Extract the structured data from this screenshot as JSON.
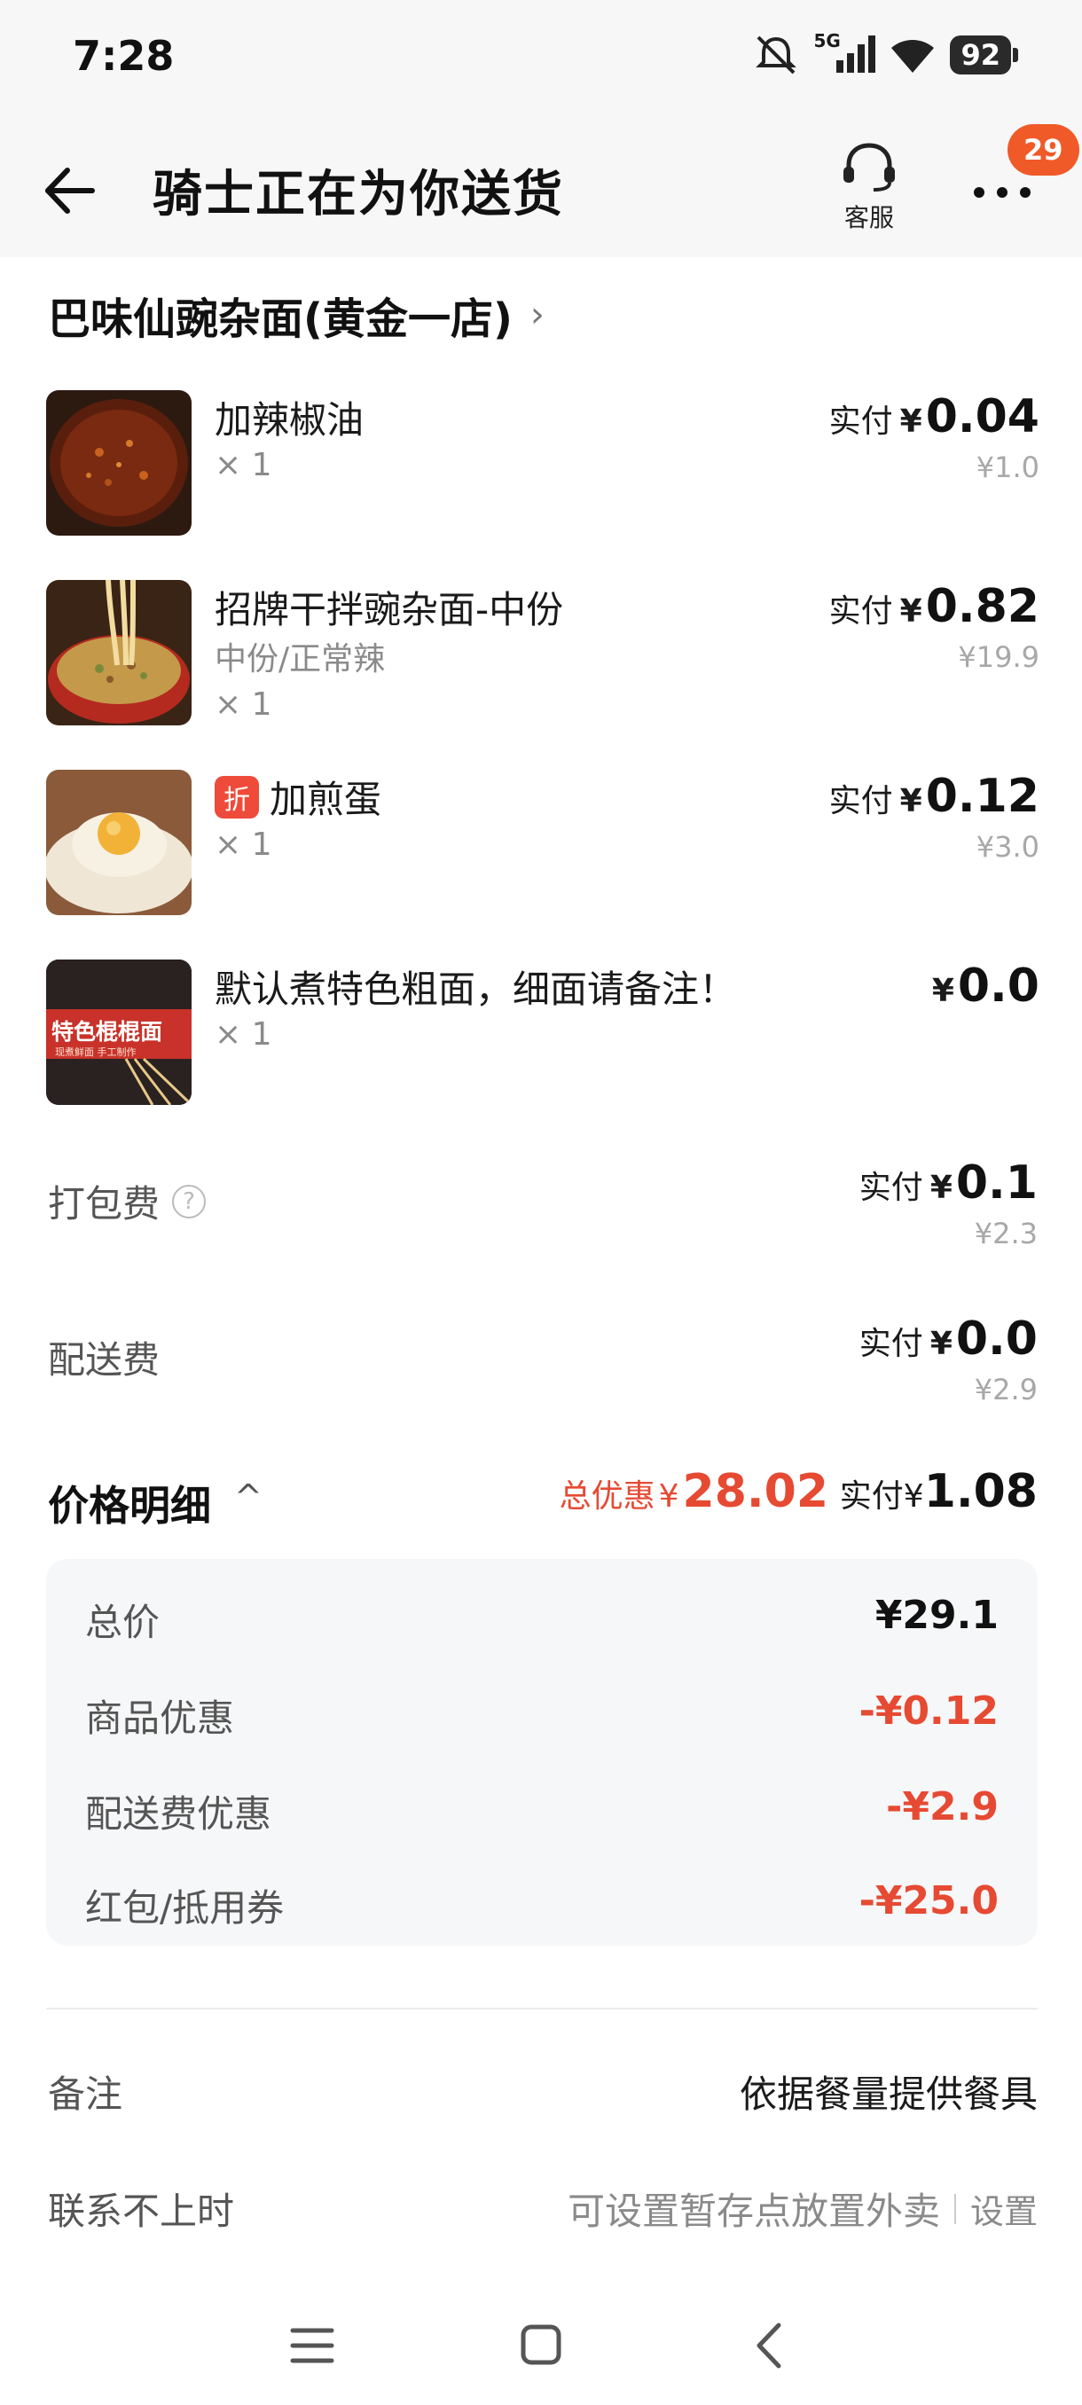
{
  "status_bar": {
    "time": "7:28",
    "network": "5G",
    "battery": "92"
  },
  "header": {
    "title": "骑士正在为你送货",
    "cs_label": "客服",
    "badge": "29"
  },
  "shop": {
    "name": "巴味仙豌杂面(黄金一店)"
  },
  "items": [
    {
      "name": "加辣椒油",
      "spec": "",
      "qty": "× 1",
      "paid_label": "实付",
      "currency": "¥",
      "paid": "0.04",
      "original": "¥1.0",
      "discount_tag": ""
    },
    {
      "name": "招牌干拌豌杂面-中份",
      "spec": "中份/正常辣",
      "qty": "× 1",
      "paid_label": "实付",
      "currency": "¥",
      "paid": "0.82",
      "original": "¥19.9",
      "discount_tag": ""
    },
    {
      "name": "加煎蛋",
      "spec": "",
      "qty": "× 1",
      "paid_label": "实付",
      "currency": "¥",
      "paid": "0.12",
      "original": "¥3.0",
      "discount_tag": "折"
    },
    {
      "name": "默认煮特色粗面，细面请备注！",
      "spec": "",
      "qty": "× 1",
      "paid_label": "",
      "currency": "¥",
      "paid": "0.0",
      "original": "",
      "discount_tag": "",
      "thumb_text": "特色棍棍面",
      "thumb_subtext": "现煮鲜面 手工制作"
    }
  ],
  "fees": [
    {
      "label": "打包费",
      "help_icon": "?",
      "paid_label": "实付",
      "currency": "¥",
      "paid": "0.1",
      "original": "¥2.3"
    },
    {
      "label": "配送费",
      "paid_label": "实付",
      "currency": "¥",
      "paid": "0.0",
      "original": "¥2.9"
    }
  ],
  "breakdown": {
    "title": "价格明细",
    "total_discount_label": "总优惠",
    "currency": "¥",
    "total_discount": "28.02",
    "paid_label": "实付",
    "paid": "1.08",
    "rows": [
      {
        "name": "总价",
        "value": "¥29.1",
        "tone": "dark"
      },
      {
        "name": "商品优惠",
        "value": "-¥0.12",
        "tone": "red"
      },
      {
        "name": "配送费优惠",
        "value": "-¥2.9",
        "tone": "red"
      },
      {
        "name": "红包/抵用券",
        "value": "-¥25.0",
        "tone": "red"
      }
    ]
  },
  "notes": {
    "remark_label": "备注",
    "remark_value": "依据餐量提供餐具",
    "contact_label": "联系不上时",
    "contact_value": "可设置暂存点放置外卖",
    "contact_action": "设置"
  },
  "colors": {
    "accent_red": "#e64a33",
    "badge_orange": "#f05a28",
    "discount_tag": "#ef4b3a"
  },
  "icons": [
    "back-arrow-icon",
    "headset-icon",
    "more-dots-icon",
    "chevron-right-icon",
    "chevron-up-icon",
    "help-icon",
    "menu-icon",
    "home-square-icon",
    "back-triangle-icon"
  ]
}
